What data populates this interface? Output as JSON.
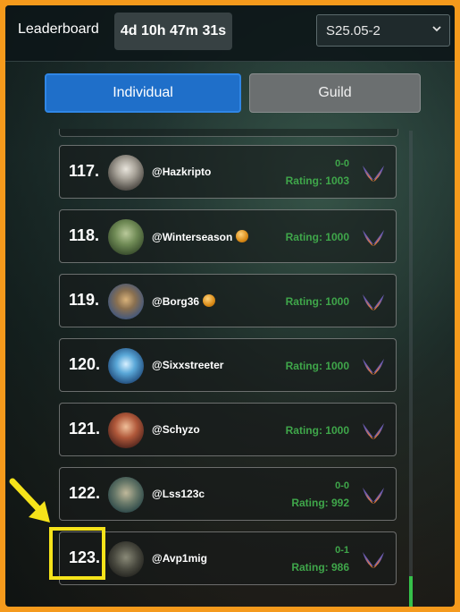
{
  "header": {
    "title": "Leaderboard",
    "timer": "4d 10h 47m 31s",
    "season": "S25.05-2"
  },
  "tabs": [
    {
      "label": "Individual",
      "active": true
    },
    {
      "label": "Guild",
      "active": false
    }
  ],
  "rows": [
    {
      "rank": "117.",
      "username": "@Hazkripto",
      "record": "0-0",
      "rating": "Rating: 1003",
      "crown": false
    },
    {
      "rank": "118.",
      "username": "@Winterseason",
      "record": "",
      "rating": "Rating: 1000",
      "crown": true
    },
    {
      "rank": "119.",
      "username": "@Borg36",
      "record": "",
      "rating": "Rating: 1000",
      "crown": true
    },
    {
      "rank": "120.",
      "username": "@Sixxstreeter",
      "record": "",
      "rating": "Rating: 1000",
      "crown": false
    },
    {
      "rank": "121.",
      "username": "@Schyzo",
      "record": "",
      "rating": "Rating: 1000",
      "crown": false
    },
    {
      "rank": "122.",
      "username": "@Lss123c",
      "record": "0-0",
      "rating": "Rating: 992",
      "crown": false
    },
    {
      "rank": "123.",
      "username": "@Avp1mig",
      "record": "0-1",
      "rating": "Rating: 986",
      "crown": false
    }
  ],
  "colors": {
    "frame": "#f59a1c",
    "accent_blue": "#1f6fc9",
    "rating_green": "#3fa64a",
    "highlight": "#f6e31a"
  },
  "icons": {
    "league": "wings-icon",
    "dropdown": "chevron-down-icon",
    "annotation": "arrow-icon"
  }
}
